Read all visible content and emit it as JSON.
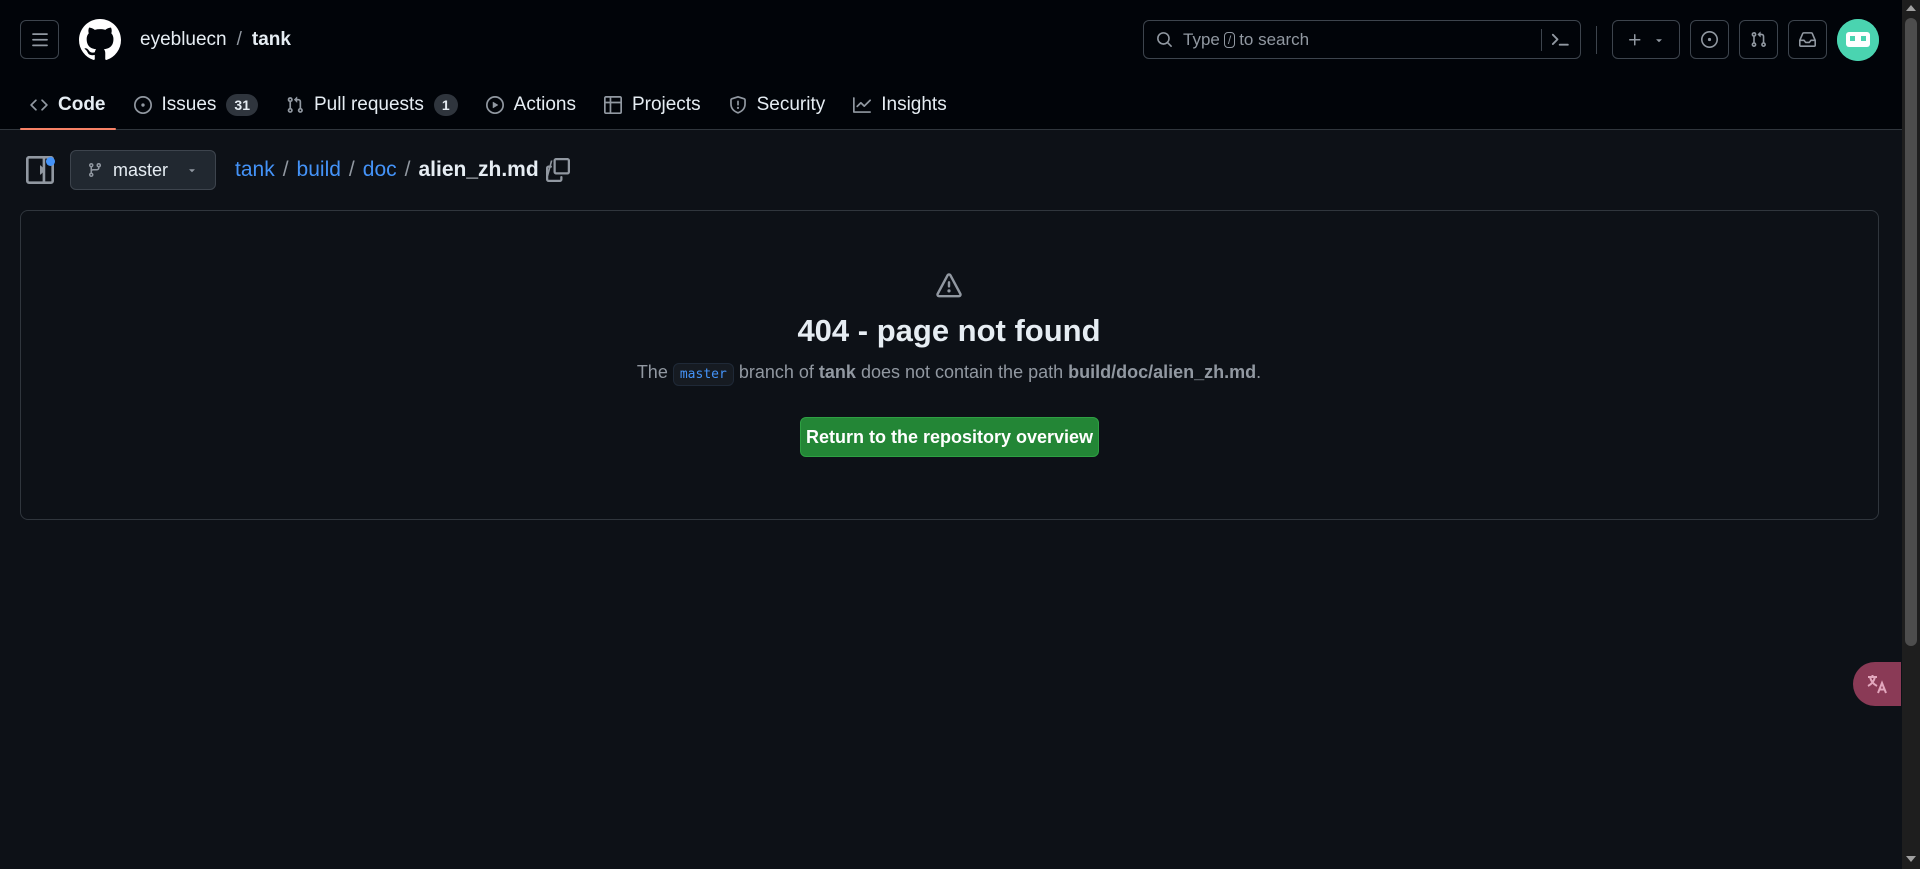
{
  "header": {
    "owner": "eyebluecn",
    "separator": "/",
    "repo": "tank",
    "search": {
      "prefix": "Type",
      "key": "/",
      "suffix": "to search"
    }
  },
  "nav": {
    "tabs": [
      {
        "label": "Code",
        "icon": "code-icon",
        "active": true
      },
      {
        "label": "Issues",
        "icon": "issue-icon",
        "count": "31"
      },
      {
        "label": "Pull requests",
        "icon": "pull-request-icon",
        "count": "1"
      },
      {
        "label": "Actions",
        "icon": "play-icon"
      },
      {
        "label": "Projects",
        "icon": "table-icon"
      },
      {
        "label": "Security",
        "icon": "shield-icon"
      },
      {
        "label": "Insights",
        "icon": "graph-icon"
      }
    ]
  },
  "branch": {
    "name": "master"
  },
  "breadcrumb": {
    "parts": [
      "tank",
      "build",
      "doc"
    ],
    "current": "alien_zh.md",
    "sep": "/"
  },
  "error": {
    "title": "404 - page not found",
    "text_the": "The",
    "branch": "master",
    "text_branch_of": "branch of",
    "repo": "tank",
    "text_no_path": "does not contain the path",
    "path": "build/doc/alien_zh.md",
    "period": ".",
    "button": "Return to the repository overview"
  },
  "colors": {
    "background": "#0d1117",
    "header": "#010409",
    "link": "#4493f8",
    "primary_button": "#238636",
    "active_tab_underline": "#f78166"
  }
}
